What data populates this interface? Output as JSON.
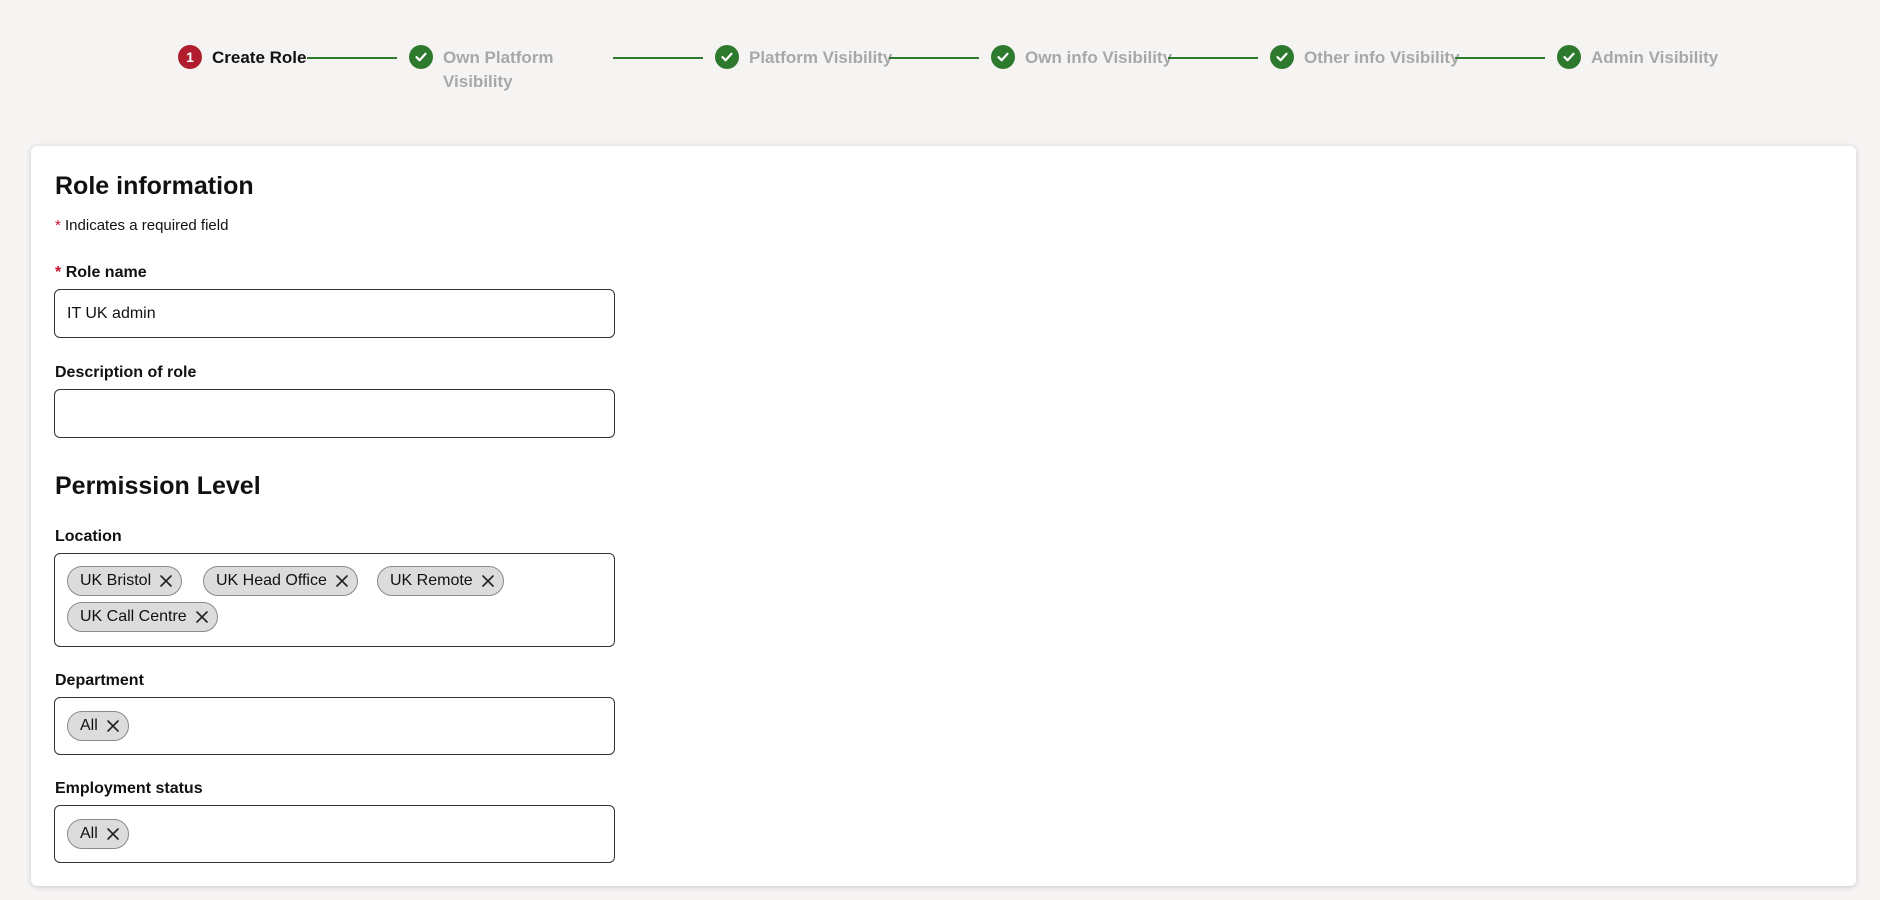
{
  "stepper": {
    "steps": [
      {
        "number": "1",
        "label": "Create Role",
        "status": "current"
      },
      {
        "label": "Own Platform Visibility",
        "status": "complete"
      },
      {
        "label": "Platform Visibility",
        "status": "complete"
      },
      {
        "label": "Own info Visibility",
        "status": "complete"
      },
      {
        "label": "Other info Visibility",
        "status": "complete"
      },
      {
        "label": "Admin Visibility",
        "status": "complete"
      }
    ],
    "colors": {
      "current": "#b01e2d",
      "complete": "#2d7a2e"
    }
  },
  "role_info": {
    "title": "Role information",
    "required_marker": "*",
    "required_note": "Indicates a required field"
  },
  "role_name": {
    "label": "Role name",
    "value": "IT UK admin"
  },
  "description": {
    "label": "Description of role",
    "value": ""
  },
  "permission": {
    "title": "Permission Level",
    "location": {
      "label": "Location",
      "tags": [
        "UK Bristol",
        "UK Head Office",
        "UK Remote",
        "UK Call Centre"
      ]
    },
    "department": {
      "label": "Department",
      "tags": [
        "All"
      ]
    },
    "employment_status": {
      "label": "Employment status",
      "tags": [
        "All"
      ]
    }
  },
  "icons": {
    "remove_tag": "close-icon",
    "step_complete": "check-icon"
  }
}
